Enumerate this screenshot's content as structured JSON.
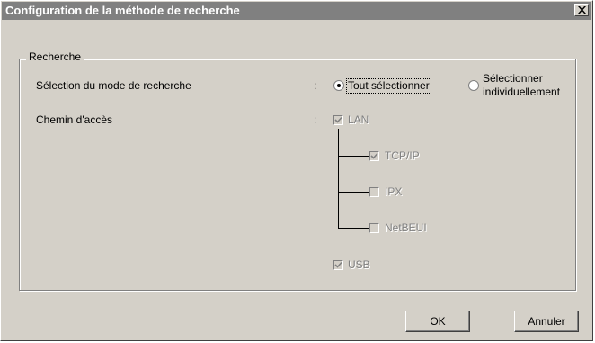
{
  "dialog": {
    "title": "Configuration de la méthode de recherche"
  },
  "group": {
    "legend": "Recherche"
  },
  "search_mode": {
    "label": "Sélection du mode de recherche",
    "colon": ":",
    "options": [
      {
        "label": "Tout sélectionner",
        "selected": true
      },
      {
        "label_line1": "Sélectionner",
        "label_line2": "individuellement",
        "selected": false
      }
    ]
  },
  "access_path": {
    "label": "Chemin d'accès",
    "colon": ":",
    "items": [
      {
        "label": "LAN",
        "checked": true,
        "enabled": false
      },
      {
        "label": "TCP/IP",
        "checked": true,
        "enabled": false
      },
      {
        "label": "IPX",
        "checked": false,
        "enabled": false
      },
      {
        "label": "NetBEUI",
        "checked": false,
        "enabled": false
      },
      {
        "label": "USB",
        "checked": true,
        "enabled": false
      }
    ]
  },
  "buttons": {
    "ok": "OK",
    "cancel": "Annuler"
  },
  "icons": {
    "close": "close-icon",
    "check": "checkmark-icon"
  },
  "colors": {
    "dialog_bg": "#d4d0c8",
    "title_bar": "#808080",
    "disabled_text": "#808080"
  }
}
